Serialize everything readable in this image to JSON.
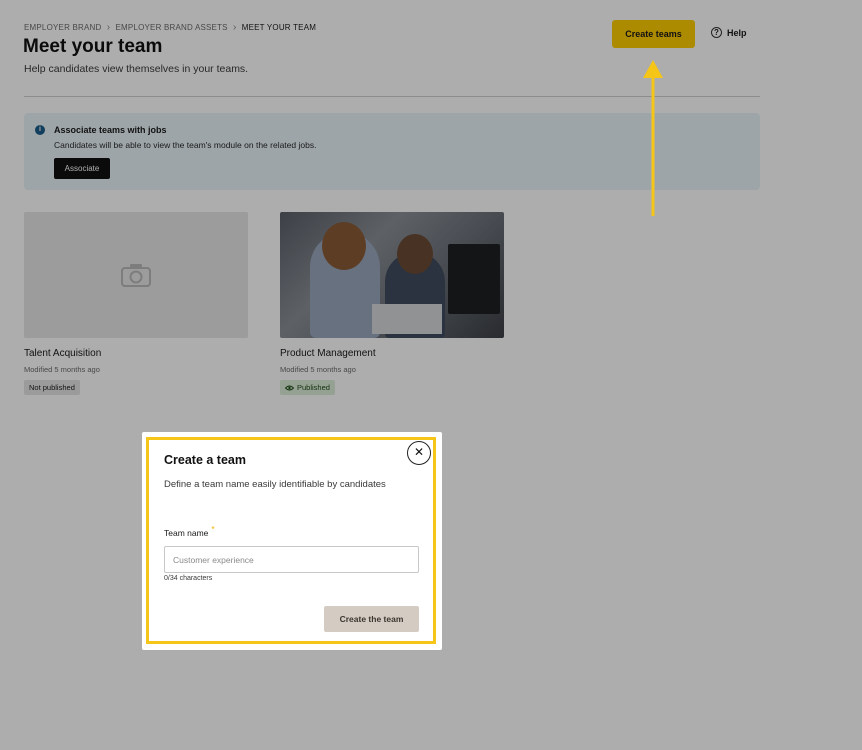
{
  "breadcrumb": {
    "items": [
      "EMPLOYER BRAND",
      "EMPLOYER BRAND ASSETS"
    ],
    "current": "MEET YOUR TEAM"
  },
  "header": {
    "title": "Meet your team",
    "subtitle": "Help candidates view themselves in your teams.",
    "create_teams_label": "Create teams",
    "help_label": "Help"
  },
  "banner": {
    "title": "Associate teams with jobs",
    "text": "Candidates will be able to view the team's module on the related jobs.",
    "button_label": "Associate"
  },
  "teams": [
    {
      "name": "Talent Acquisition",
      "modified": "Modified 5 months ago",
      "status": "Not published"
    },
    {
      "name": "Product Management",
      "modified": "Modified 5 months ago",
      "status": "Published"
    }
  ],
  "modal": {
    "title": "Create a team",
    "description": "Define a team name easily identifiable by candidates",
    "field_label": "Team name",
    "required_mark": "*",
    "input_value": "",
    "input_placeholder": "Customer experience",
    "char_count": "0/34 characters",
    "submit_label": "Create the team",
    "close_symbol": "✕"
  },
  "colors": {
    "accent": "#ffcd00",
    "highlight_frame": "#f5c518",
    "banner_bg": "#e9f4f8",
    "published_bg": "#dcedd7"
  },
  "icons": {
    "breadcrumb_separator": "chevron-right-icon",
    "help": "question-circle-icon",
    "info": "info-icon",
    "image_placeholder": "camera-icon",
    "published": "eye-icon",
    "close": "close-icon",
    "annotation": "arrow-up-icon"
  }
}
